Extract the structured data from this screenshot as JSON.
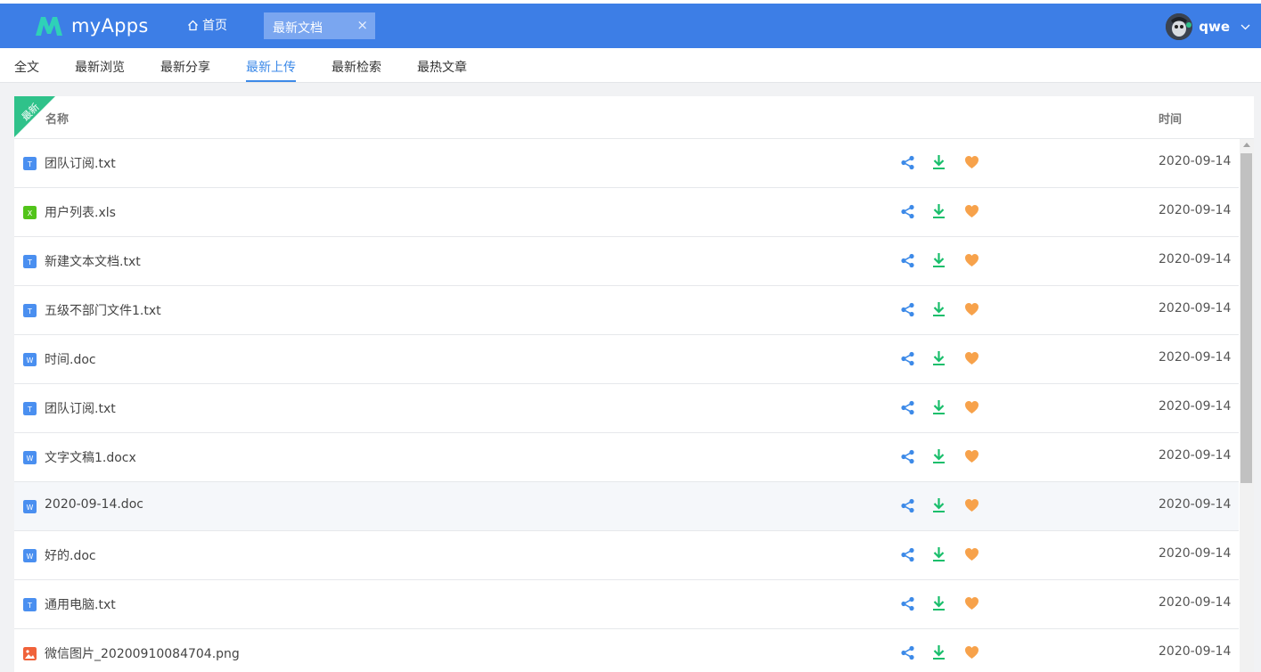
{
  "app": {
    "brand": "myApps",
    "home_label": "首页"
  },
  "tabs": [
    {
      "label": "最新文档",
      "close": "×"
    }
  ],
  "user": {
    "name": "qwe"
  },
  "subnav": [
    "全文",
    "最新浏览",
    "最新分享",
    "最新上传",
    "最新检索",
    "最热文章"
  ],
  "subnav_active": "最新上传",
  "ribbon_text": "最新",
  "table": {
    "headers": {
      "name": "名称",
      "time": "时间"
    },
    "rows": [
      {
        "name": "团队订阅.txt",
        "type": "txt",
        "time": "2020-09-14"
      },
      {
        "name": "用户列表.xls",
        "type": "xls",
        "time": "2020-09-14"
      },
      {
        "name": "新建文本文档.txt",
        "type": "txt",
        "time": "2020-09-14"
      },
      {
        "name": "五级不部门文件1.txt",
        "type": "txt",
        "time": "2020-09-14"
      },
      {
        "name": "时间.doc",
        "type": "doc",
        "time": "2020-09-14"
      },
      {
        "name": "团队订阅.txt",
        "type": "txt",
        "time": "2020-09-14"
      },
      {
        "name": "文字文稿1.docx",
        "type": "doc",
        "time": "2020-09-14"
      },
      {
        "name": "2020-09-14.doc",
        "type": "doc",
        "time": "2020-09-14",
        "hover": true
      },
      {
        "name": "好的.doc",
        "type": "doc",
        "time": "2020-09-14"
      },
      {
        "name": "通用电脑.txt",
        "type": "txt",
        "time": "2020-09-14"
      },
      {
        "name": "微信图片_20200910084704.png",
        "type": "png",
        "time": "2020-09-14"
      }
    ]
  },
  "file_icons": {
    "txt": {
      "color": "#4a8ff0",
      "glyph": "T"
    },
    "xls": {
      "color": "#52c41a",
      "glyph": "X"
    },
    "doc": {
      "color": "#4a8ff0",
      "glyph": "W"
    },
    "png": {
      "color": "#f0623a",
      "glyph": ""
    }
  },
  "colors": {
    "header": "#3d7ee6",
    "share": "#3d8ae8",
    "download": "#19be6b",
    "like": "#f7a24b",
    "ribbon": "#2fc28a",
    "active_tab": "#3d8ae8"
  },
  "action_icons": [
    "share-icon",
    "download-icon",
    "heart-icon"
  ]
}
